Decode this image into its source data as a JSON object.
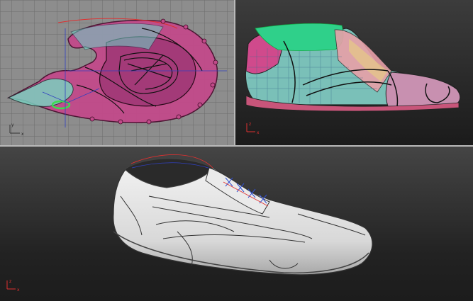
{
  "viewports": {
    "top": {
      "axis_x": "x",
      "axis_y": "y"
    },
    "perspective": {
      "axis_z": "z",
      "axis_x": "x"
    },
    "main": {
      "axis_z": "z",
      "axis_x": "x"
    }
  },
  "colors": {
    "top_bg": "#8d8d8d",
    "sole_magenta": "#c24a8a",
    "mesh_cyan": "#5fd0c0",
    "collar_green": "#2fd08a",
    "shoe_white": "#e6e6e6",
    "axis_red": "#e03030"
  },
  "icons": [
    "axis-gizmo-icon"
  ]
}
